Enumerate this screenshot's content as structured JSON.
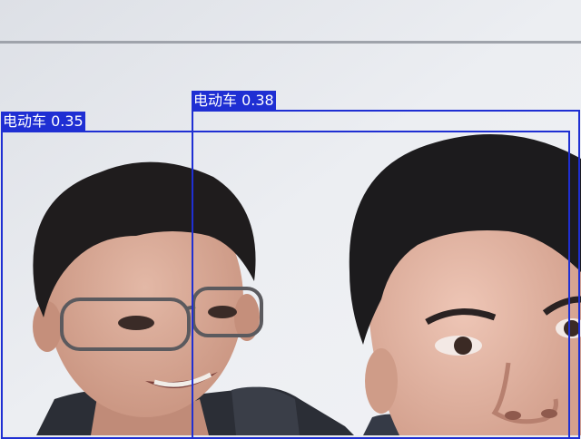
{
  "detections": [
    {
      "label": "电动车",
      "score": "0.35",
      "caption": "电动车 0.35",
      "color": "#1f2fd3"
    },
    {
      "label": "电动车",
      "score": "0.38",
      "caption": "电动车 0.38",
      "color": "#1f2fd3"
    }
  ],
  "scene": {
    "background": "#e9ebef",
    "description": "two people in front of a light wall"
  }
}
